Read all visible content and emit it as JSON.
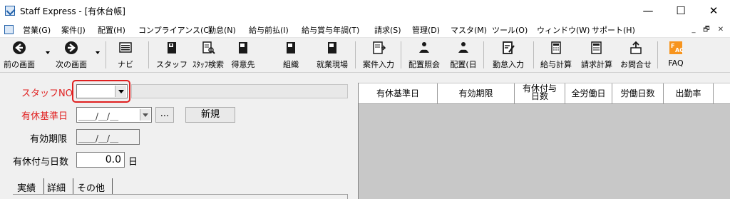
{
  "window": {
    "title": "Staff Express - [有休台帳]",
    "minimize": "—",
    "maximize": "☐",
    "close": "✕"
  },
  "menu": {
    "items": [
      "営業(G)",
      "案件(J)",
      "配置(H)",
      "コンプライアンス(C)",
      "勤怠(N)",
      "給与前払(I)",
      "給与賞与年調(T)",
      "請求(S)",
      "管理(D)",
      "マスタ(M)",
      "ツール(O)",
      "ウィンドウ(W)",
      "サポート(H)"
    ],
    "mdi": [
      "_",
      "🗗",
      "✕"
    ]
  },
  "toolbar": {
    "buttons": [
      {
        "label": "前の画面",
        "icon": "back-arrow-icon"
      },
      {
        "label": "次の画面",
        "icon": "forward-arrow-icon"
      },
      {
        "label": "ナビ",
        "icon": "navi-keyboard-icon"
      },
      {
        "label": "スタッフ",
        "icon": "staff-book-icon"
      },
      {
        "label": "ｽﾀｯﾌ検索",
        "icon": "staff-search-icon"
      },
      {
        "label": "得意先",
        "icon": "client-book-icon"
      },
      {
        "label": "組織",
        "icon": "organization-book-icon"
      },
      {
        "label": "就業現場",
        "icon": "worksite-book-icon"
      },
      {
        "label": "案件入力",
        "icon": "project-entry-icon"
      },
      {
        "label": "配置照会",
        "icon": "assignment-inquiry-icon"
      },
      {
        "label": "配置(日",
        "icon": "assignment-daily-icon"
      },
      {
        "label": "勤怠入力",
        "icon": "attendance-entry-icon"
      },
      {
        "label": "給与計算",
        "icon": "payroll-calc-icon"
      },
      {
        "label": "請求計算",
        "icon": "billing-calc-icon"
      },
      {
        "label": "お問合せ",
        "icon": "inquiry-icon"
      },
      {
        "label": "FAQ",
        "icon": "faq-icon"
      }
    ]
  },
  "form": {
    "staff_no_label": "スタッフNO",
    "base_date_label": "有休基準日",
    "base_date_value": "＿＿/＿/＿",
    "ellipsis": "...",
    "new_button": "新規",
    "expiry_label": "有効期限",
    "expiry_value": "＿＿/＿/＿",
    "grant_days_label": "有休付与日数",
    "grant_days_value": "0.0",
    "days_unit": "日"
  },
  "tabs": [
    "実績",
    "詳細",
    "その他"
  ],
  "grid": {
    "columns": [
      "有休基準日",
      "有効期限",
      "有休付与日数",
      "全労働日",
      "労働日数",
      "出勤率"
    ]
  },
  "colors": {
    "required_label": "#e02020",
    "highlight_box": "#e02020",
    "grid_bg": "#c8c8c8"
  }
}
